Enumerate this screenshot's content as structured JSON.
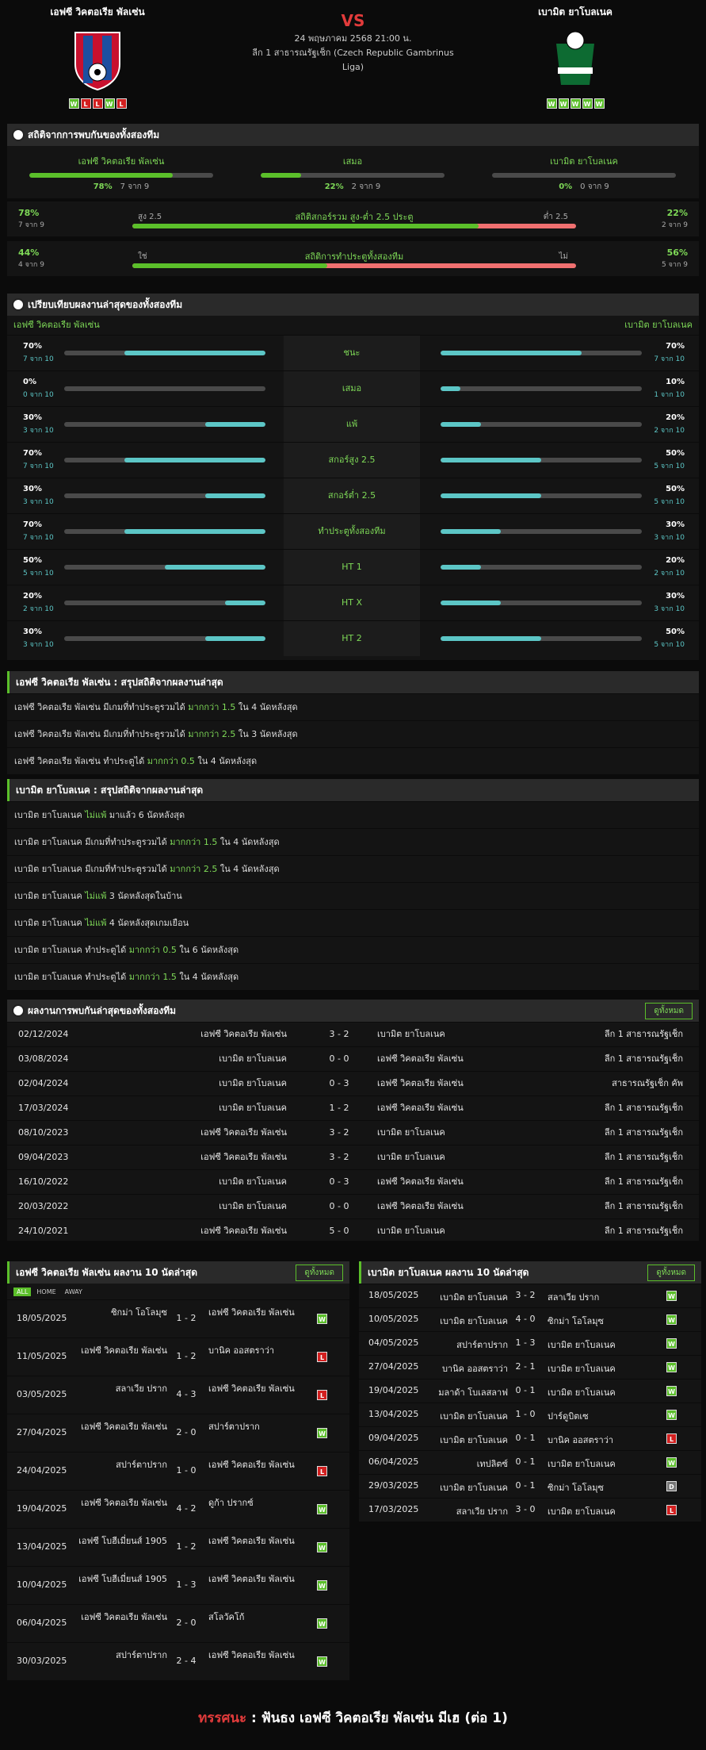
{
  "header": {
    "home": "เอฟซี วิคตอเรีย พัลเซ่น",
    "away": "เบามิต ยาโบลเนค",
    "vs": "VS",
    "date": "24 พฤษภาคม 2568 21:00 น.",
    "league": "ลีก 1 สาธารณรัฐเช็ก (Czech Republic Gambrinus Liga)",
    "home_form": [
      "W",
      "L",
      "L",
      "W",
      "L"
    ],
    "away_form": [
      "W",
      "W",
      "W",
      "W",
      "W"
    ]
  },
  "h2h_stats": {
    "title": "สถิติจากการพบกันของทั้งสองทีม",
    "home": {
      "name": "เอฟซี วิคตอเรีย พัลเซ่น",
      "pct": "78%",
      "of": "7 จาก 9",
      "fill": 78
    },
    "draw": {
      "name": "เสมอ",
      "pct": "22%",
      "of": "2 จาก 9",
      "fill": 22
    },
    "away": {
      "name": "เบามิต ยาโบลเนค",
      "pct": "0%",
      "of": "0 จาก 9",
      "fill": 0
    },
    "ou": {
      "label": "สถิติสกอร์รวม สูง-ต่ำ 2.5 ประตู",
      "left_tag": "สูง 2.5",
      "right_tag": "ต่ำ 2.5",
      "lv": "78%",
      "ls": "7 จาก 9",
      "rv": "22%",
      "rs": "2 จาก 9",
      "fill": 78
    },
    "btts": {
      "label": "สถิติการทำประตูทั้งสองทีม",
      "left_tag": "ใช่",
      "right_tag": "ไม่",
      "lv": "44%",
      "ls": "4 จาก 9",
      "rv": "56%",
      "rs": "5 จาก 9",
      "fill": 44
    }
  },
  "compare": {
    "title": "เปรียบเทียบผลงานล่าสุดของทั้งสองทีม",
    "home": "เอฟซี วิคตอเรีย พัลเซ่น",
    "away": "เบามิต ยาโบลเนค",
    "rows": [
      {
        "label": "ชนะ",
        "lp": "70%",
        "ls": "7 จาก 10",
        "rp": "70%",
        "rs": "7 จาก 10",
        "lf": 70,
        "rf": 70
      },
      {
        "label": "เสมอ",
        "lp": "0%",
        "ls": "0 จาก 10",
        "rp": "10%",
        "rs": "1 จาก 10",
        "lf": 0,
        "rf": 10
      },
      {
        "label": "แพ้",
        "lp": "30%",
        "ls": "3 จาก 10",
        "rp": "20%",
        "rs": "2 จาก 10",
        "lf": 30,
        "rf": 20
      },
      {
        "label": "สกอร์สูง 2.5",
        "lp": "70%",
        "ls": "7 จาก 10",
        "rp": "50%",
        "rs": "5 จาก 10",
        "lf": 70,
        "rf": 50
      },
      {
        "label": "สกอร์ต่ำ 2.5",
        "lp": "30%",
        "ls": "3 จาก 10",
        "rp": "50%",
        "rs": "5 จาก 10",
        "lf": 30,
        "rf": 50
      },
      {
        "label": "ทำประตูทั้งสองทีม",
        "lp": "70%",
        "ls": "7 จาก 10",
        "rp": "30%",
        "rs": "3 จาก 10",
        "lf": 70,
        "rf": 30
      },
      {
        "label": "HT 1",
        "lp": "50%",
        "ls": "5 จาก 10",
        "rp": "20%",
        "rs": "2 จาก 10",
        "lf": 50,
        "rf": 20
      },
      {
        "label": "HT X",
        "lp": "20%",
        "ls": "2 จาก 10",
        "rp": "30%",
        "rs": "3 จาก 10",
        "lf": 20,
        "rf": 30
      },
      {
        "label": "HT 2",
        "lp": "30%",
        "ls": "3 จาก 10",
        "rp": "50%",
        "rs": "5 จาก 10",
        "lf": 30,
        "rf": 50
      }
    ]
  },
  "home_summary": {
    "title": "เอฟซี วิคตอเรีย พัลเซ่น : สรุปสถิติจากผลงานล่าสุด",
    "rows": [
      [
        "เอฟซี วิคตอเรีย พัลเซ่น มีเกมที่ทำประตูรวมได้ ",
        "มากกว่า 1.5",
        " ใน 4 นัดหลังสุด"
      ],
      [
        "เอฟซี วิคตอเรีย พัลเซ่น มีเกมที่ทำประตูรวมได้ ",
        "มากกว่า 2.5",
        " ใน 3 นัดหลังสุด"
      ],
      [
        "เอฟซี วิคตอเรีย พัลเซ่น ทำประตูได้ ",
        "มากกว่า 0.5",
        " ใน 4 นัดหลังสุด"
      ]
    ]
  },
  "away_summary": {
    "title": "เบามิต ยาโบลเนค : สรุปสถิติจากผลงานล่าสุด",
    "rows": [
      [
        "เบามิต ยาโบลเนค ",
        "ไม่แพ้",
        " มาแล้ว 6 นัดหลังสุด"
      ],
      [
        "เบามิต ยาโบลเนค มีเกมที่ทำประตูรวมได้ ",
        "มากกว่า 1.5",
        " ใน 4 นัดหลังสุด"
      ],
      [
        "เบามิต ยาโบลเนค มีเกมที่ทำประตูรวมได้ ",
        "มากกว่า 2.5",
        " ใน 4 นัดหลังสุด"
      ],
      [
        "เบามิต ยาโบลเนค ",
        "ไม่แพ้",
        " 3 นัดหลังสุดในบ้าน"
      ],
      [
        "เบามิต ยาโบลเนค ",
        "ไม่แพ้",
        " 4 นัดหลังสุดเกมเยือน"
      ],
      [
        "เบามิต ยาโบลเนค ทำประตูได้ ",
        "มากกว่า 0.5",
        " ใน 6 นัดหลังสุด"
      ],
      [
        "เบามิต ยาโบลเนค ทำประตูได้ ",
        "มากกว่า 1.5",
        " ใน 4 นัดหลังสุด"
      ]
    ]
  },
  "results": {
    "title": "ผลงานการพบกันล่าสุดของทั้งสองทีม",
    "all": "ดูทั้งหมด",
    "rows": [
      [
        "02/12/2024",
        "เอฟซี วิคตอเรีย พัลเซ่น",
        "3 - 2",
        "เบามิต ยาโบลเนค",
        "ลีก 1 สาธารณรัฐเช็ก"
      ],
      [
        "03/08/2024",
        "เบามิต ยาโบลเนค",
        "0 - 0",
        "เอฟซี วิคตอเรีย พัลเซ่น",
        "ลีก 1 สาธารณรัฐเช็ก"
      ],
      [
        "02/04/2024",
        "เบามิต ยาโบลเนค",
        "0 - 3",
        "เอฟซี วิคตอเรีย พัลเซ่น",
        "สาธารณรัฐเช็ก คัพ"
      ],
      [
        "17/03/2024",
        "เบามิต ยาโบลเนค",
        "1 - 2",
        "เอฟซี วิคตอเรีย พัลเซ่น",
        "ลีก 1 สาธารณรัฐเช็ก"
      ],
      [
        "08/10/2023",
        "เอฟซี วิคตอเรีย พัลเซ่น",
        "3 - 2",
        "เบามิต ยาโบลเนค",
        "ลีก 1 สาธารณรัฐเช็ก"
      ],
      [
        "09/04/2023",
        "เอฟซี วิคตอเรีย พัลเซ่น",
        "3 - 2",
        "เบามิต ยาโบลเนค",
        "ลีก 1 สาธารณรัฐเช็ก"
      ],
      [
        "16/10/2022",
        "เบามิต ยาโบลเนค",
        "0 - 3",
        "เอฟซี วิคตอเรีย พัลเซ่น",
        "ลีก 1 สาธารณรัฐเช็ก"
      ],
      [
        "20/03/2022",
        "เบามิต ยาโบลเนค",
        "0 - 0",
        "เอฟซี วิคตอเรีย พัลเซ่น",
        "ลีก 1 สาธารณรัฐเช็ก"
      ],
      [
        "24/10/2021",
        "เอฟซี วิคตอเรีย พัลเซ่น",
        "5 - 0",
        "เบามิต ยาโบลเนค",
        "ลีก 1 สาธารณรัฐเช็ก"
      ]
    ]
  },
  "last10_home": {
    "title": "เอฟซี วิคตอเรีย พัลเซ่น ผลงาน 10 นัดล่าสุด",
    "all": "ดูทั้งหมด",
    "tabs": [
      "ALL",
      "HOME",
      "AWAY"
    ],
    "rows": [
      [
        "18/05/2025",
        "ซิกม่า โอโลมุซ",
        "1 - 2",
        "เอฟซี วิคตอเรีย พัลเซ่น",
        "W"
      ],
      [
        "11/05/2025",
        "เอฟซี วิคตอเรีย พัลเซ่น",
        "1 - 2",
        "บานิค ออสตราว่า",
        "L"
      ],
      [
        "03/05/2025",
        "สลาเวีย ปราก",
        "4 - 3",
        "เอฟซี วิคตอเรีย พัลเซ่น",
        "L"
      ],
      [
        "27/04/2025",
        "เอฟซี วิคตอเรีย พัลเซ่น",
        "2 - 0",
        "สปาร์ตาปราก",
        "W"
      ],
      [
        "24/04/2025",
        "สปาร์ตาปราก",
        "1 - 0",
        "เอฟซี วิคตอเรีย พัลเซ่น",
        "L"
      ],
      [
        "19/04/2025",
        "เอฟซี วิคตอเรีย พัลเซ่น",
        "4 - 2",
        "ดูก้า ปรากซ์",
        "W"
      ],
      [
        "13/04/2025",
        "เอฟซี โบฮีเมี่ยนส์ 1905",
        "1 - 2",
        "เอฟซี วิคตอเรีย พัลเซ่น",
        "W"
      ],
      [
        "10/04/2025",
        "เอฟซี โบฮีเมี่ยนส์ 1905",
        "1 - 3",
        "เอฟซี วิคตอเรีย พัลเซ่น",
        "W"
      ],
      [
        "06/04/2025",
        "เอฟซี วิคตอเรีย พัลเซ่น",
        "2 - 0",
        "สโลวัคโก้",
        "W"
      ],
      [
        "30/03/2025",
        "สปาร์ตาปราก",
        "2 - 4",
        "เอฟซี วิคตอเรีย พัลเซ่น",
        "W"
      ]
    ]
  },
  "last10_away": {
    "title": "เบามิต ยาโบลเนค ผลงาน 10 นัดล่าสุด",
    "all": "ดูทั้งหมด",
    "rows": [
      [
        "18/05/2025",
        "เบามิต ยาโบลเนค",
        "3 - 2",
        "สลาเวีย ปราก",
        "W"
      ],
      [
        "10/05/2025",
        "เบามิต ยาโบลเนค",
        "4 - 0",
        "ซิกม่า โอโลมุซ",
        "W"
      ],
      [
        "04/05/2025",
        "สปาร์ตาปราก",
        "1 - 3",
        "เบามิต ยาโบลเนค",
        "W"
      ],
      [
        "27/04/2025",
        "บานิค ออสตราว่า",
        "2 - 1",
        "เบามิต ยาโบลเนค",
        "W"
      ],
      [
        "19/04/2025",
        "มลาด้า โบเลสลาฟ",
        "0 - 1",
        "เบามิต ยาโบลเนค",
        "W"
      ],
      [
        "13/04/2025",
        "เบามิต ยาโบลเนค",
        "1 - 0",
        "ปาร์ดูบิตเซ",
        "W"
      ],
      [
        "09/04/2025",
        "เบามิต ยาโบลเนค",
        "0 - 1",
        "บานิค ออสตราว่า",
        "L"
      ],
      [
        "06/04/2025",
        "เทปลิตซ์",
        "0 - 1",
        "เบามิต ยาโบลเนค",
        "W"
      ],
      [
        "29/03/2025",
        "เบามิต ยาโบลเนค",
        "0 - 1",
        "ซิกม่า โอโลมุซ",
        "D"
      ],
      [
        "17/03/2025",
        "สลาเวีย ปราก",
        "3 - 0",
        "เบามิต ยาโบลเนค",
        "L"
      ]
    ]
  },
  "tip": {
    "label": "ทรรศนะ",
    "sep": " : ",
    "text": "ฟันธง เอฟซี วิคตอเรีย พัลเซ่น มีเฮ (ต่อ 1)"
  },
  "colors": {
    "green": "#5bbf2a",
    "teal": "#5cc6c6",
    "red": "#e23b3b",
    "loss_bar": "#f07070"
  }
}
